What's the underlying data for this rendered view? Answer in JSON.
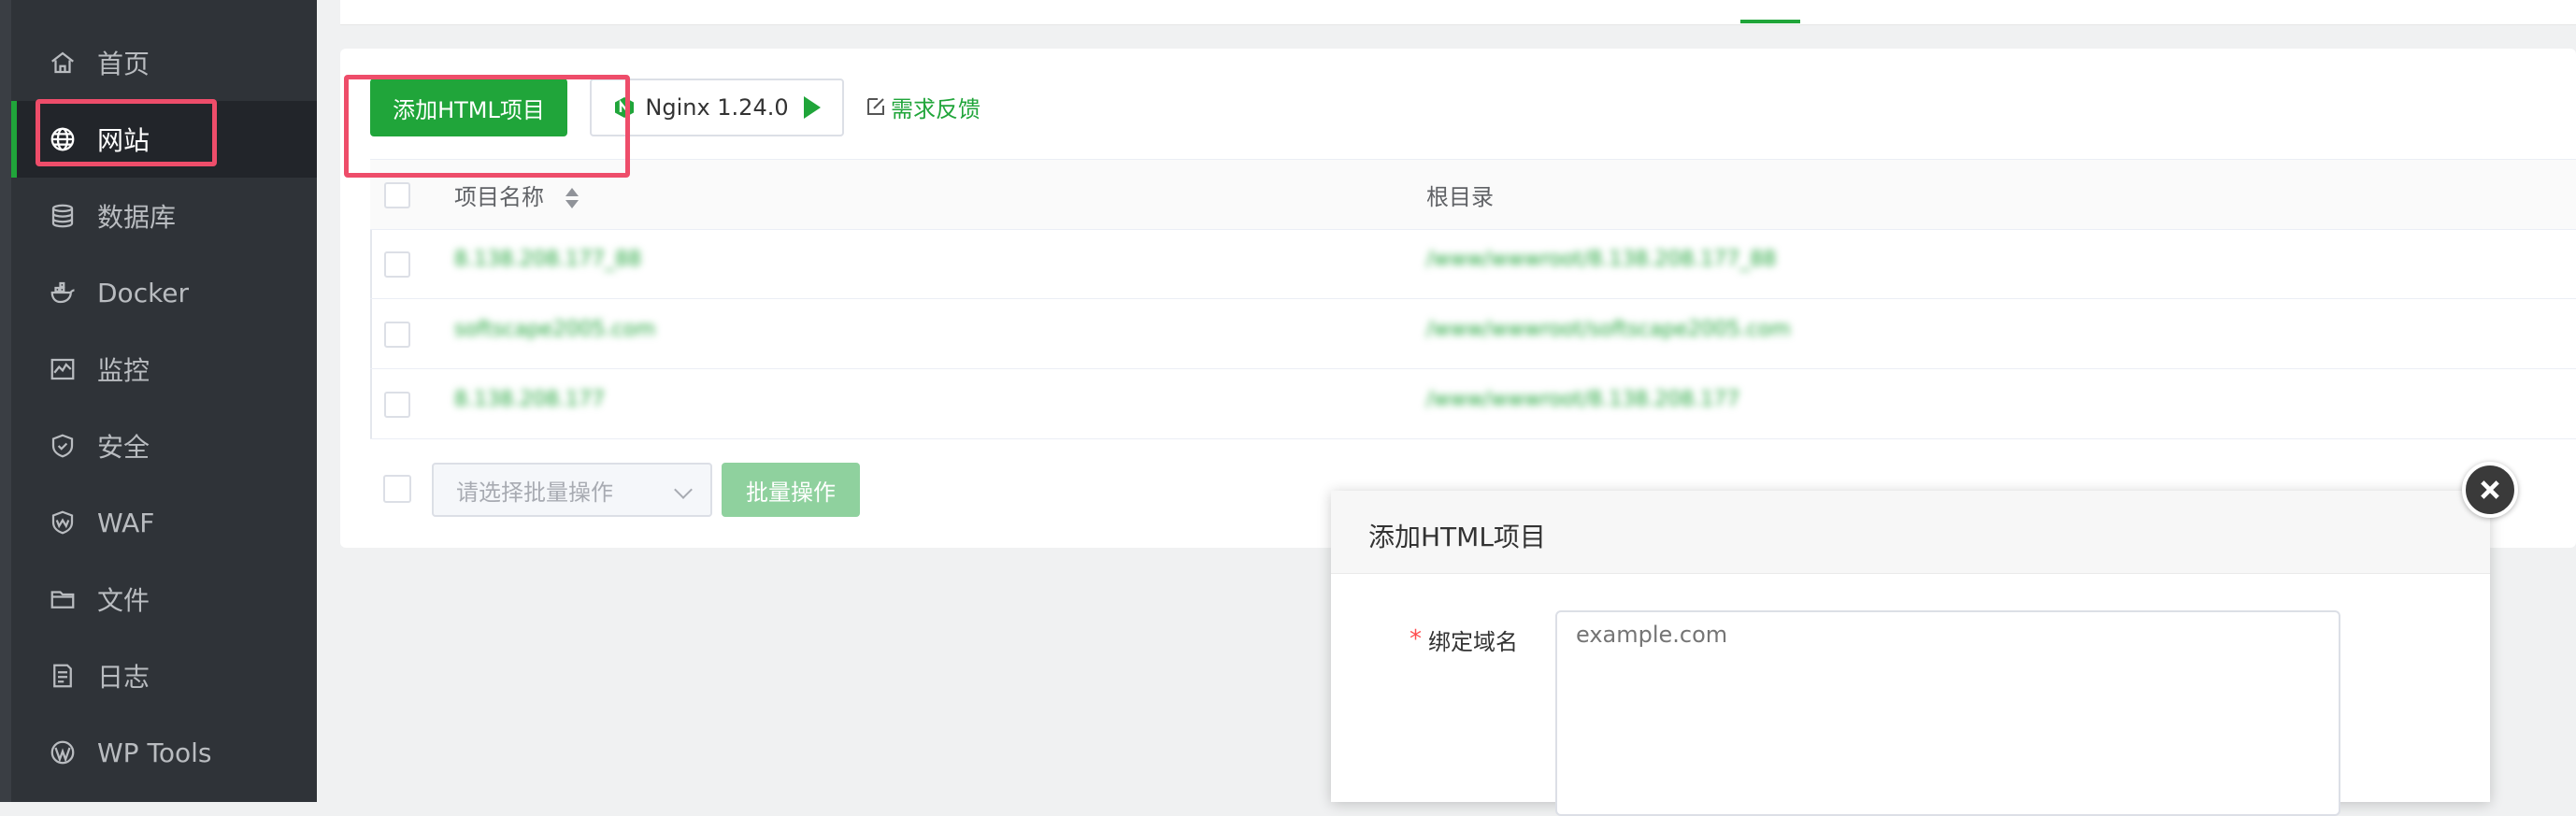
{
  "sidebar": {
    "items": [
      {
        "label": "首页",
        "icon": "home-icon"
      },
      {
        "label": "网站",
        "icon": "globe-icon",
        "active": true
      },
      {
        "label": "数据库",
        "icon": "database-icon"
      },
      {
        "label": "Docker",
        "icon": "docker-icon"
      },
      {
        "label": "监控",
        "icon": "monitor-icon"
      },
      {
        "label": "安全",
        "icon": "shield-icon"
      },
      {
        "label": "WAF",
        "icon": "waf-shield-icon"
      },
      {
        "label": "文件",
        "icon": "folder-icon"
      },
      {
        "label": "日志",
        "icon": "log-icon"
      },
      {
        "label": "WP Tools",
        "icon": "wordpress-icon"
      }
    ]
  },
  "toolbar": {
    "add_label": "添加HTML项目",
    "nginx_label": "Nginx 1.24.0",
    "feedback_label": "需求反馈"
  },
  "table": {
    "columns": {
      "name": "项目名称",
      "path": "根目录"
    },
    "rows": [
      {
        "name": "8.138.208.177_88",
        "path": "/www/wwwroot/8.138.208.177_88"
      },
      {
        "name": "softscape2005.com",
        "path": "/www/wwwroot/softscape2005.com"
      },
      {
        "name": "8.138.208.177",
        "path": "/www/wwwroot/8.138.208.177"
      }
    ]
  },
  "batch": {
    "select_placeholder": "请选择批量操作",
    "button_label": "批量操作"
  },
  "dialog": {
    "title": "添加HTML项目",
    "required_mark": "*",
    "field_label": "绑定域名",
    "field_placeholder": "example.com"
  },
  "colors": {
    "accent": "#20a53a",
    "sidebar_bg": "#2f3338",
    "highlight": "#ee4d6a"
  }
}
